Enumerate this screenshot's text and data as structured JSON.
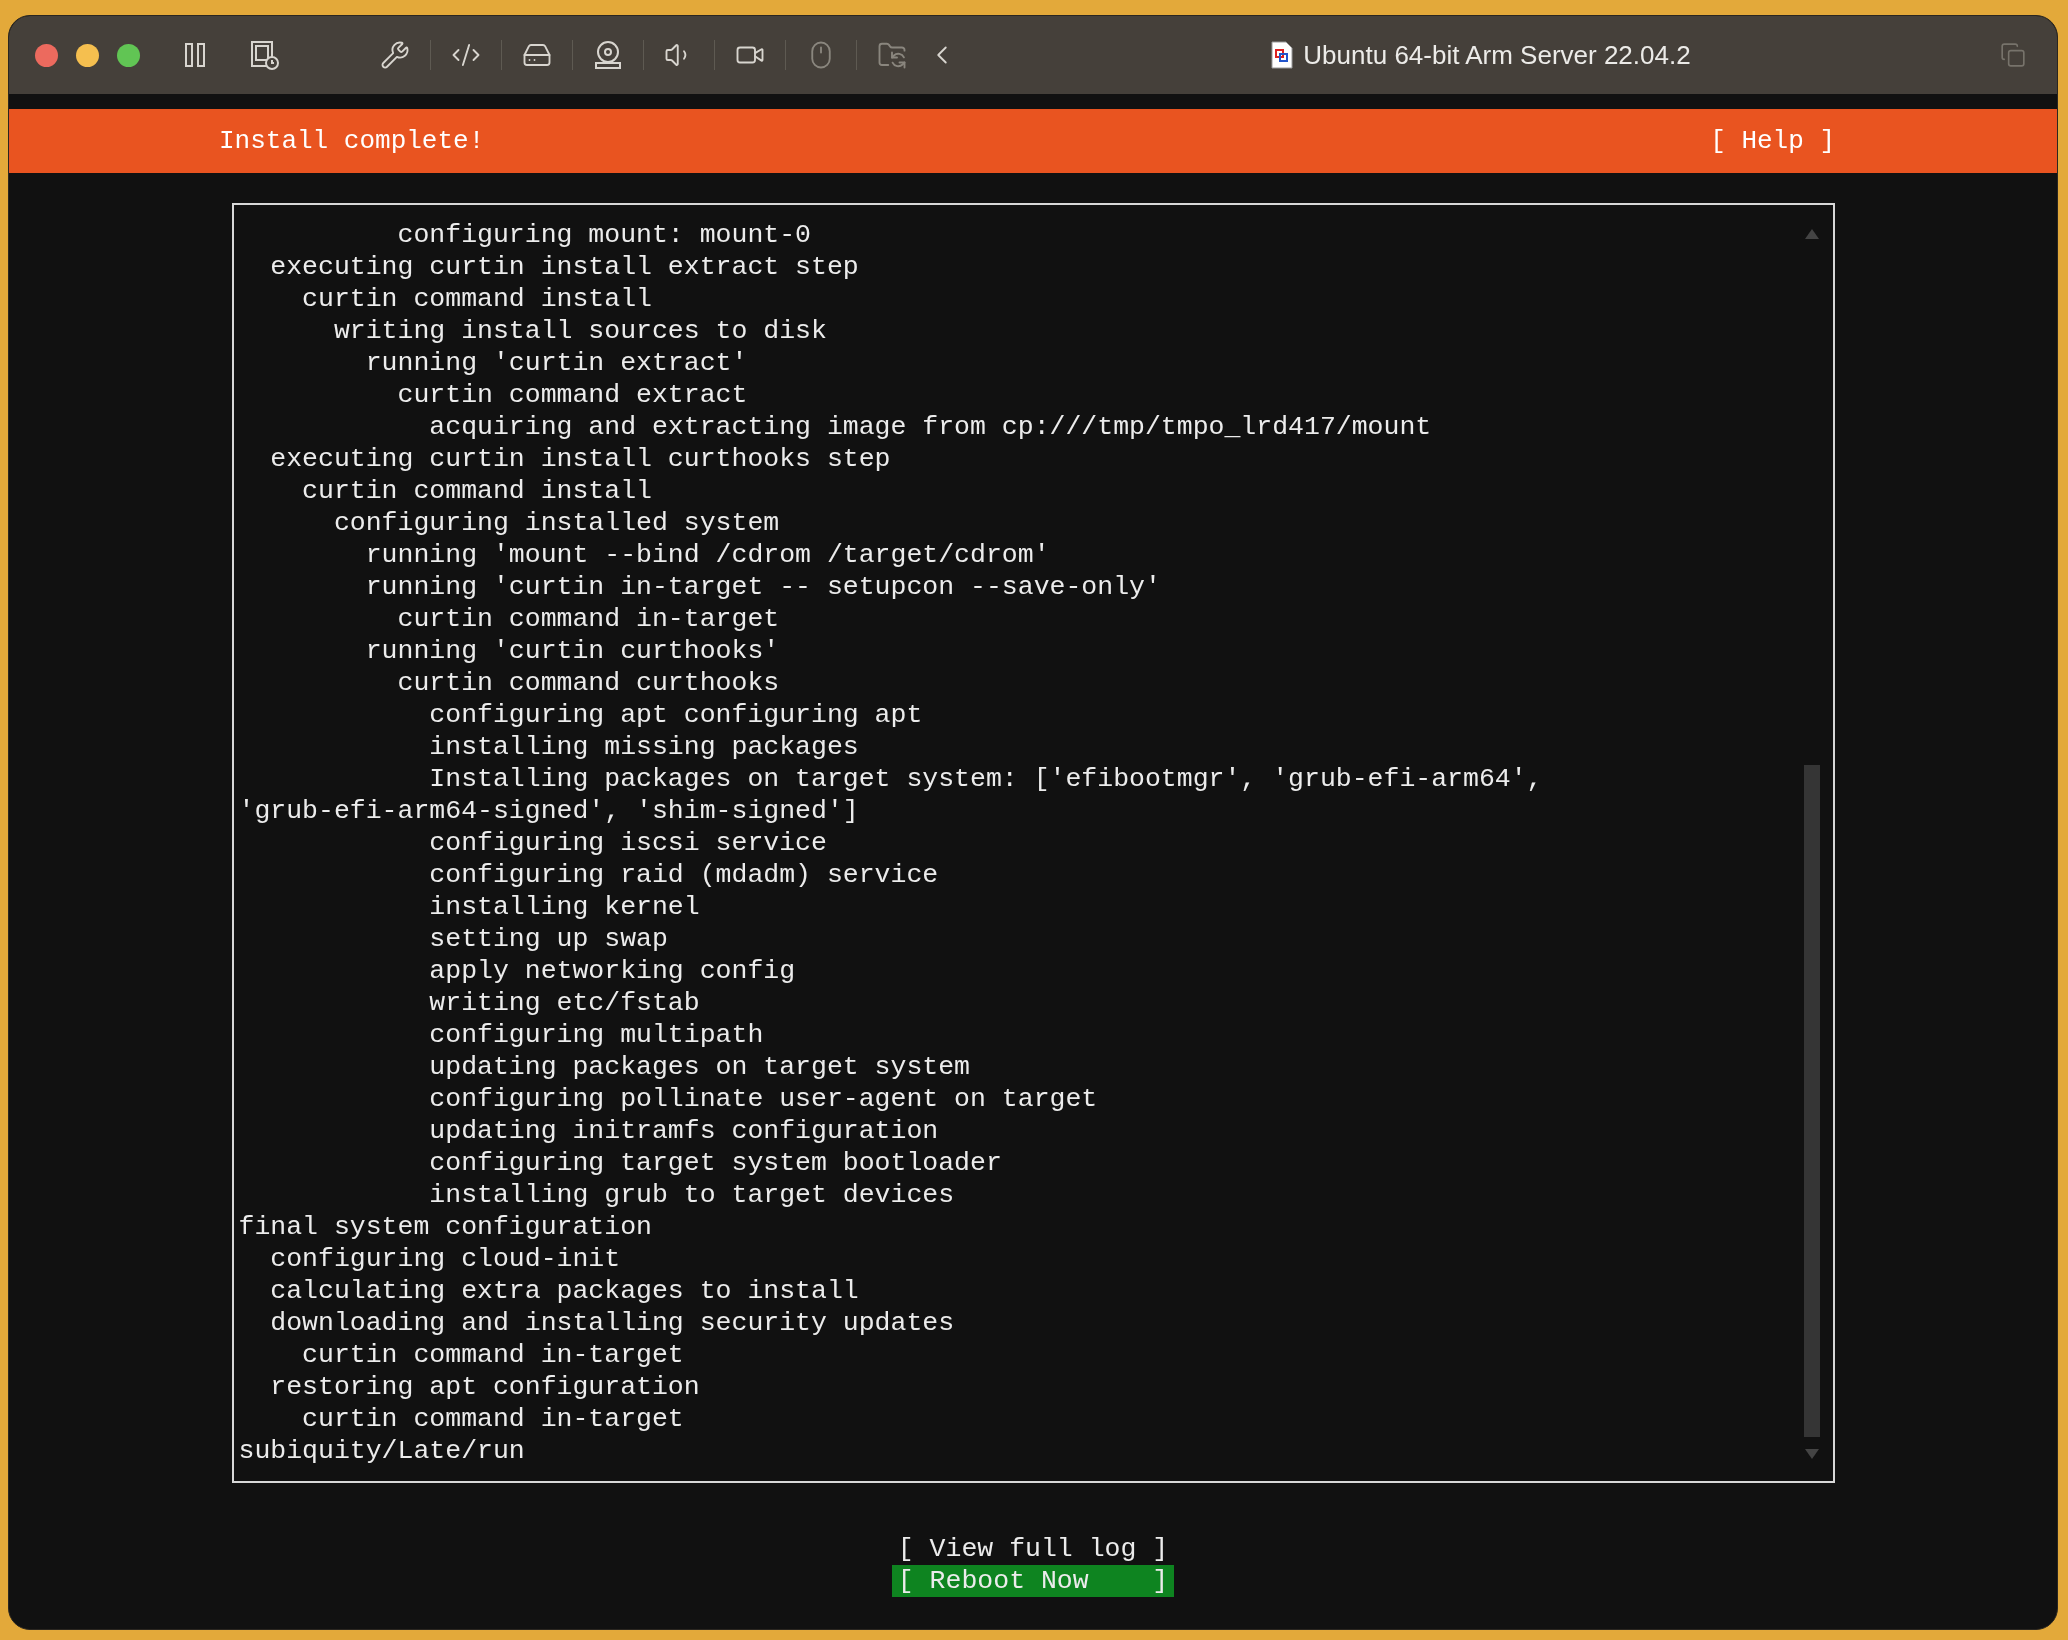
{
  "window": {
    "title": "Ubuntu 64-bit Arm Server 22.04.2"
  },
  "header": {
    "title": "Install complete!",
    "help": "[ Help ]"
  },
  "log": [
    "          configuring mount: mount-0",
    "  executing curtin install extract step",
    "    curtin command install",
    "      writing install sources to disk",
    "        running 'curtin extract'",
    "          curtin command extract",
    "            acquiring and extracting image from cp:///tmp/tmpo_lrd417/mount",
    "  executing curtin install curthooks step",
    "    curtin command install",
    "      configuring installed system",
    "        running 'mount --bind /cdrom /target/cdrom'",
    "        running 'curtin in-target -- setupcon --save-only'",
    "          curtin command in-target",
    "        running 'curtin curthooks'",
    "          curtin command curthooks",
    "            configuring apt configuring apt",
    "            installing missing packages",
    "            Installing packages on target system: ['efibootmgr', 'grub-efi-arm64',",
    "'grub-efi-arm64-signed', 'shim-signed']",
    "            configuring iscsi service",
    "            configuring raid (mdadm) service",
    "            installing kernel",
    "            setting up swap",
    "            apply networking config",
    "            writing etc/fstab",
    "            configuring multipath",
    "            updating packages on target system",
    "            configuring pollinate user-agent on target",
    "            updating initramfs configuration",
    "            configuring target system bootloader",
    "            installing grub to target devices",
    "final system configuration",
    "  configuring cloud-init",
    "  calculating extra packages to install",
    "  downloading and installing security updates",
    "    curtin command in-target",
    "  restoring apt configuration",
    "    curtin command in-target",
    "subiquity/Late/run"
  ],
  "buttons": [
    {
      "label": "[ View full log ]",
      "selected": false
    },
    {
      "label": "[ Reboot Now    ]",
      "selected": true
    }
  ]
}
